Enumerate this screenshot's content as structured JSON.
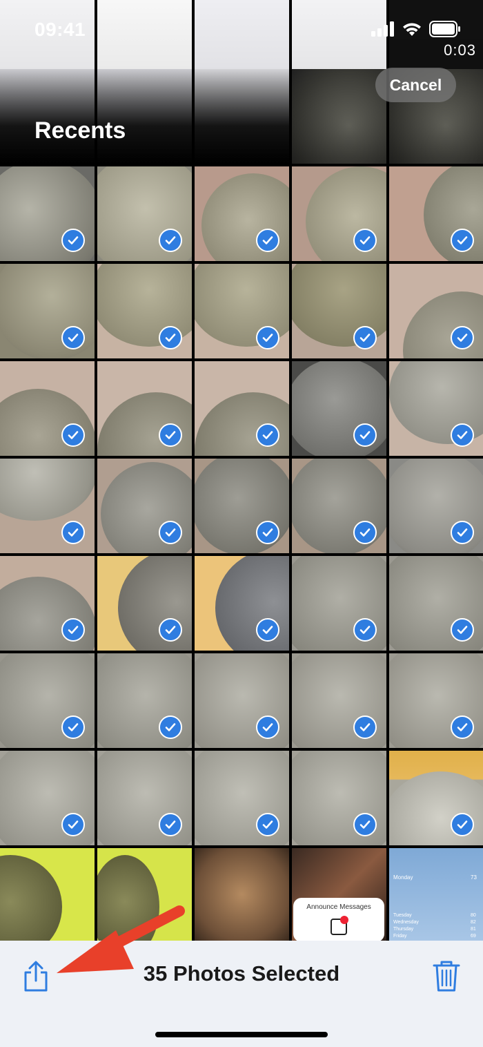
{
  "status_bar": {
    "time": "09:41",
    "recording_time": "0:03"
  },
  "header": {
    "title": "Recents",
    "cancel_label": "Cancel"
  },
  "toolbar": {
    "selection_label": "35 Photos Selected"
  },
  "icons": {
    "share": "share-icon",
    "trash": "trash-icon",
    "check": "checkmark-icon",
    "signal": "cellular-signal-icon",
    "wifi": "wifi-icon",
    "battery": "battery-icon"
  },
  "colors": {
    "accent": "#2f7de0",
    "arrow": "#e8402a",
    "toolbar_bg": "#eef1f6"
  },
  "peek_text": {
    "announce": "Announce Messages",
    "weather_day": "Monday",
    "weather_rows": [
      "Tuesday",
      "Wednesday",
      "Thursday",
      "Friday"
    ],
    "weather_hi": [
      "73",
      "80",
      "82",
      "81",
      "69"
    ]
  }
}
